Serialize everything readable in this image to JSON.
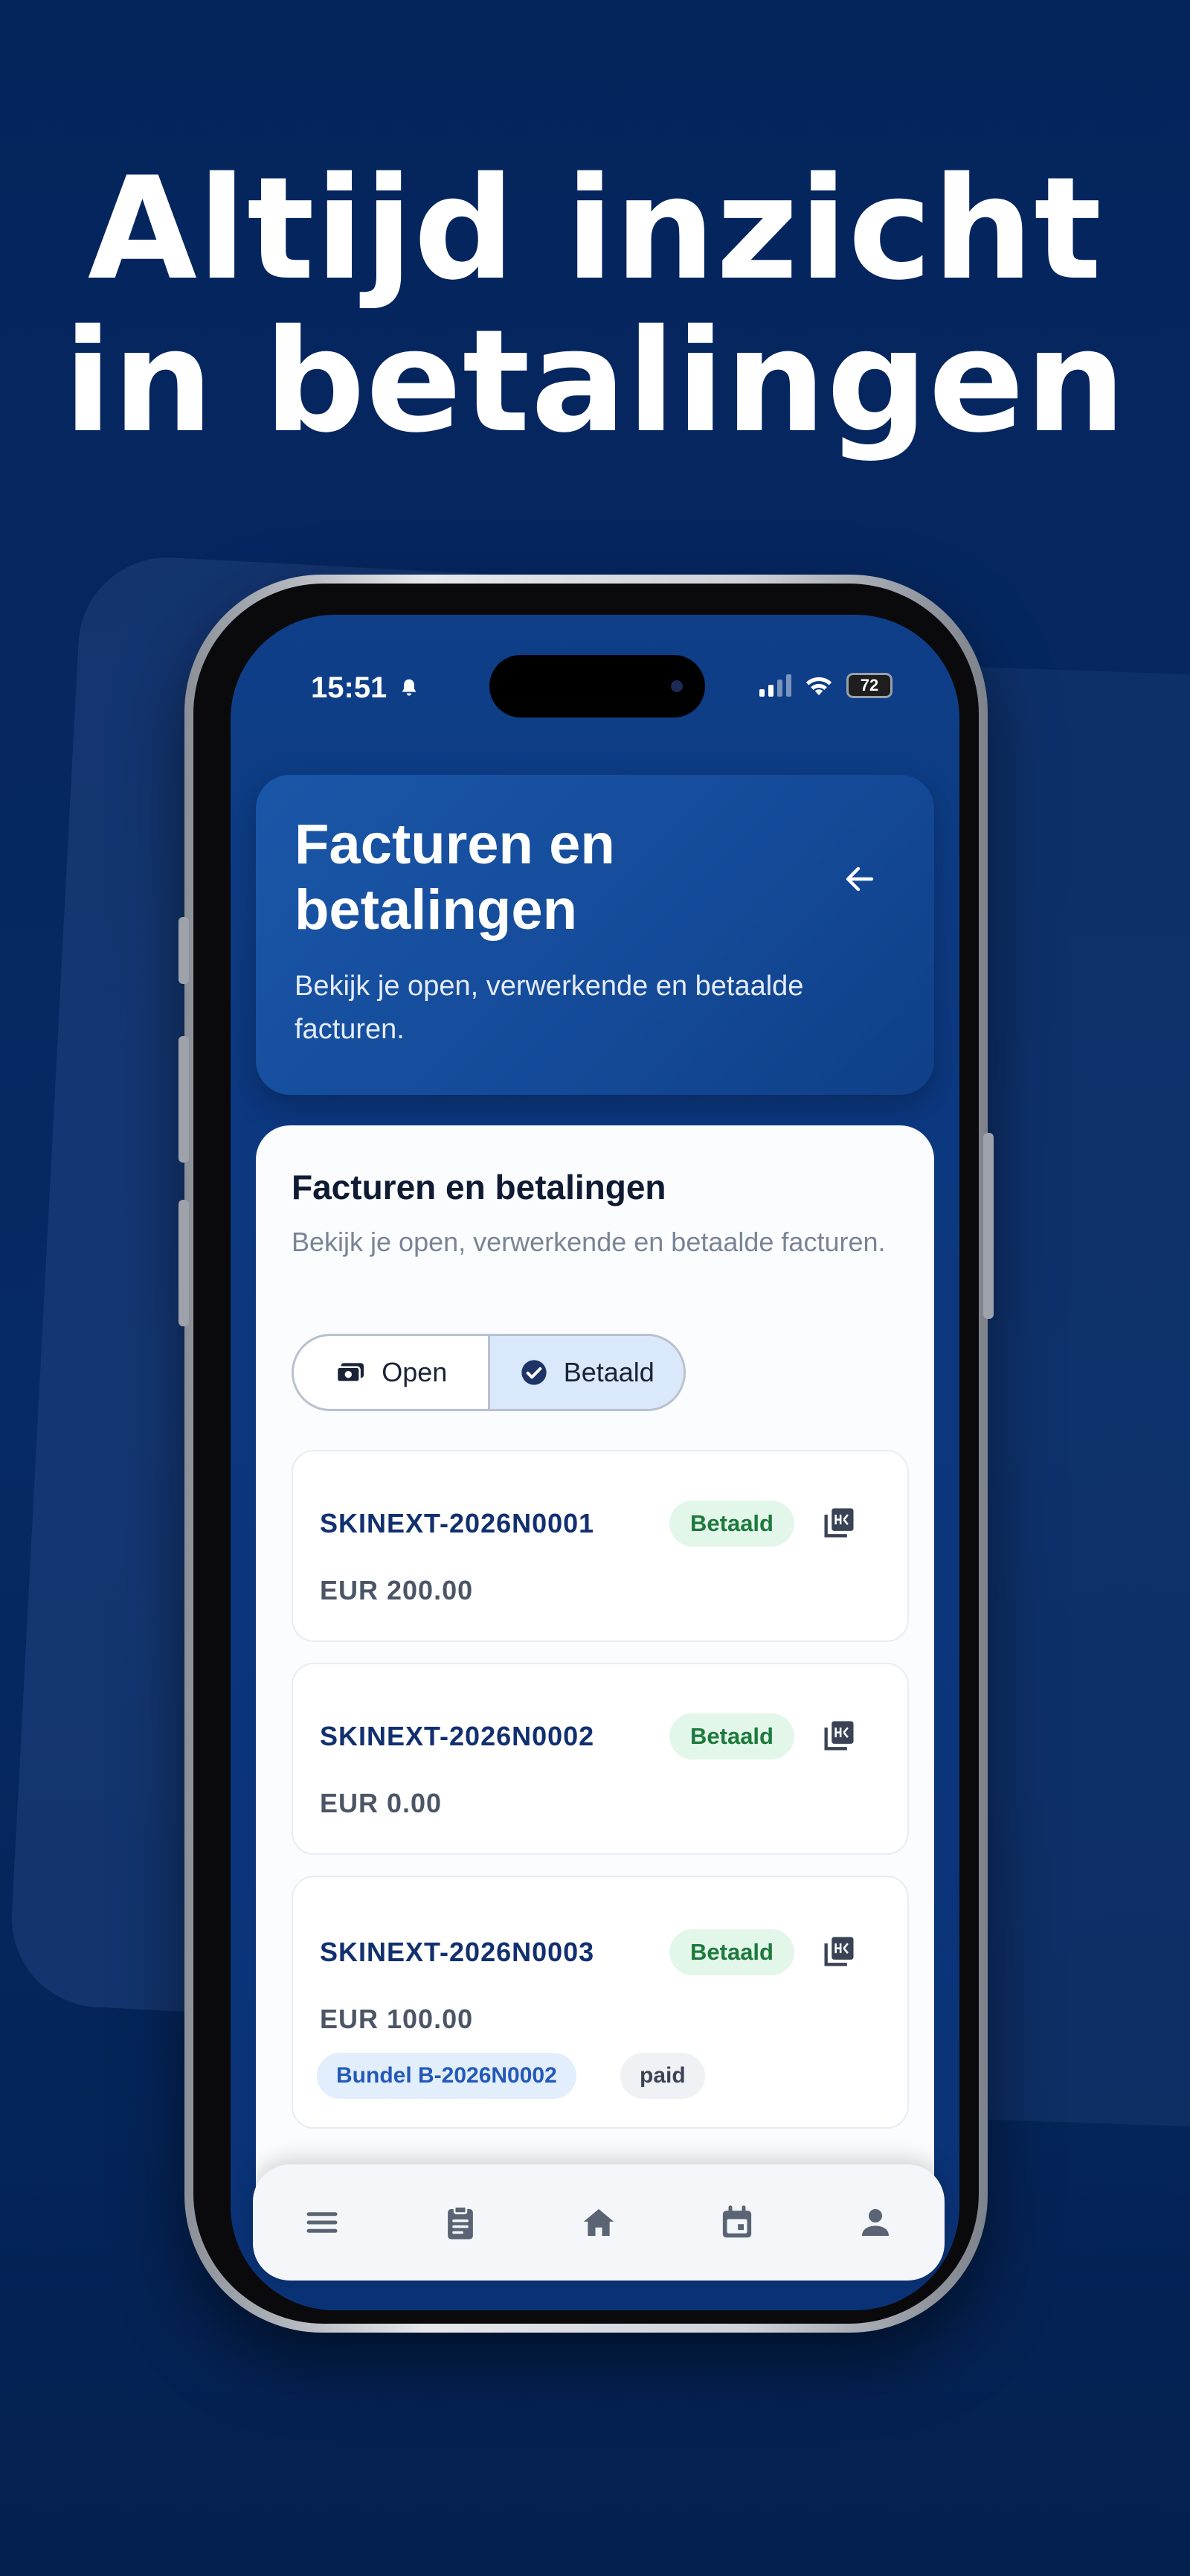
{
  "headline": {
    "line1": "Altijd inzicht",
    "line2": "in betalingen"
  },
  "status_bar": {
    "time": "15:51",
    "battery": "72"
  },
  "header": {
    "title": "Facturen en betalingen",
    "subtitle": "Bekijk je open, verwerkende en betaalde facturen.",
    "back_icon": "arrow-left-icon"
  },
  "content": {
    "title": "Facturen en betalingen",
    "subtitle": "Bekijk je open, verwerkende en betaalde facturen.",
    "tabs": [
      {
        "label": "Open",
        "icon": "cash-icon",
        "active": false
      },
      {
        "label": "Betaald",
        "icon": "check-circle-icon",
        "active": true
      }
    ],
    "invoices": [
      {
        "id": "SKINEXT-2026N0001",
        "status": "Betaald",
        "amount": "EUR 200.00"
      },
      {
        "id": "SKINEXT-2026N0002",
        "status": "Betaald",
        "amount": "EUR 0.00"
      },
      {
        "id": "SKINEXT-2026N0003",
        "status": "Betaald",
        "amount": "EUR 100.00",
        "bundle": "Bundel B-2026N0002",
        "bundle_status": "paid"
      }
    ]
  },
  "bottom_nav": [
    {
      "icon": "menu-icon"
    },
    {
      "icon": "clipboard-icon"
    },
    {
      "icon": "home-icon"
    },
    {
      "icon": "calendar-icon"
    },
    {
      "icon": "person-icon"
    }
  ],
  "colors": {
    "background": "#05245c",
    "header_card": "#1a56a8",
    "badge_bg": "#e3f6ea",
    "badge_text": "#1d7a3c",
    "invoice_id": "#123070",
    "tab_active_bg": "#d9e8fb"
  }
}
